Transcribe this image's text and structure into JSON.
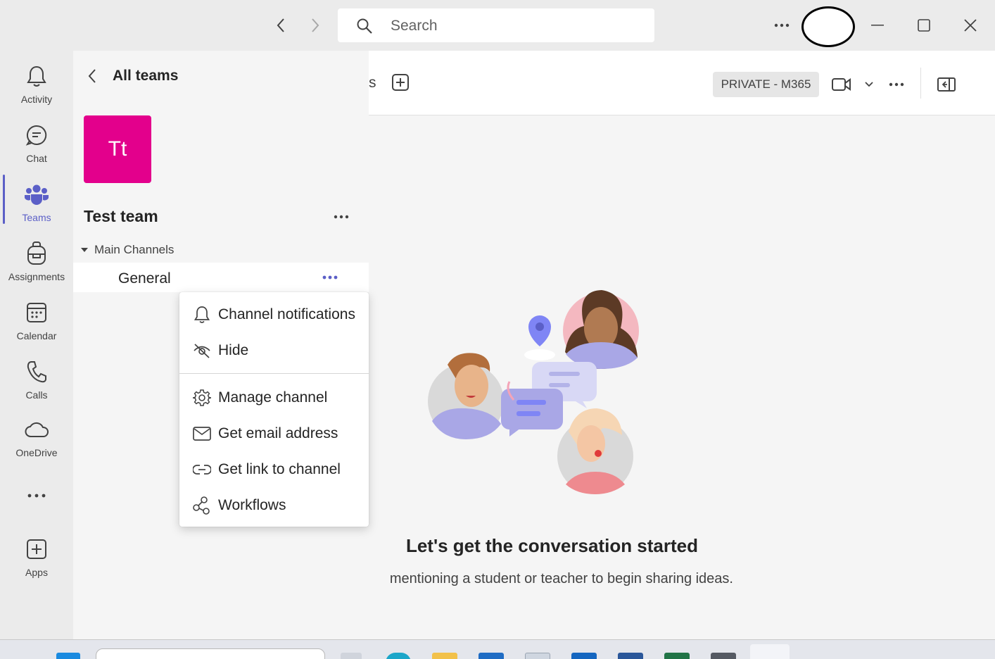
{
  "titlebar": {
    "search_placeholder": "Search",
    "back_icon": "chevron-left-icon",
    "forward_icon": "chevron-right-icon",
    "more_icon": "ellipsis-icon",
    "minimize_icon": "minimize-icon",
    "maximize_icon": "maximize-icon",
    "close_icon": "close-icon"
  },
  "rail": {
    "items": [
      {
        "label": "Activity",
        "icon": "bell-icon"
      },
      {
        "label": "Chat",
        "icon": "chat-icon"
      },
      {
        "label": "Teams",
        "icon": "teams-icon",
        "active": true
      },
      {
        "label": "Assignments",
        "icon": "backpack-icon"
      },
      {
        "label": "Calendar",
        "icon": "calendar-icon"
      },
      {
        "label": "Calls",
        "icon": "phone-icon"
      },
      {
        "label": "OneDrive",
        "icon": "cloud-icon"
      },
      {
        "label": "Apps",
        "icon": "add-app-icon"
      }
    ],
    "more_icon": "ellipsis-icon"
  },
  "panel": {
    "back_label": "All teams",
    "team_avatar": "Tt",
    "team_name": "Test team",
    "section_label": "Main Channels",
    "channel_label": "General"
  },
  "context_menu": {
    "items": [
      {
        "label": "Channel notifications",
        "icon": "bell-icon"
      },
      {
        "label": "Hide",
        "icon": "eye-off-icon"
      },
      {
        "label": "Manage channel",
        "icon": "gear-icon"
      },
      {
        "label": "Get email address",
        "icon": "mail-icon"
      },
      {
        "label": "Get link to channel",
        "icon": "link-icon"
      },
      {
        "label": "Workflows",
        "icon": "workflow-icon"
      }
    ]
  },
  "main": {
    "tab_fragment": "s",
    "private_badge": "PRIVATE - M365",
    "empty_title": "Let's get the conversation started",
    "empty_subtitle": "mentioning a student or teacher to begin sharing ideas."
  },
  "colors": {
    "accent": "#5b5fc7",
    "team_avatar": "#e3008c"
  }
}
